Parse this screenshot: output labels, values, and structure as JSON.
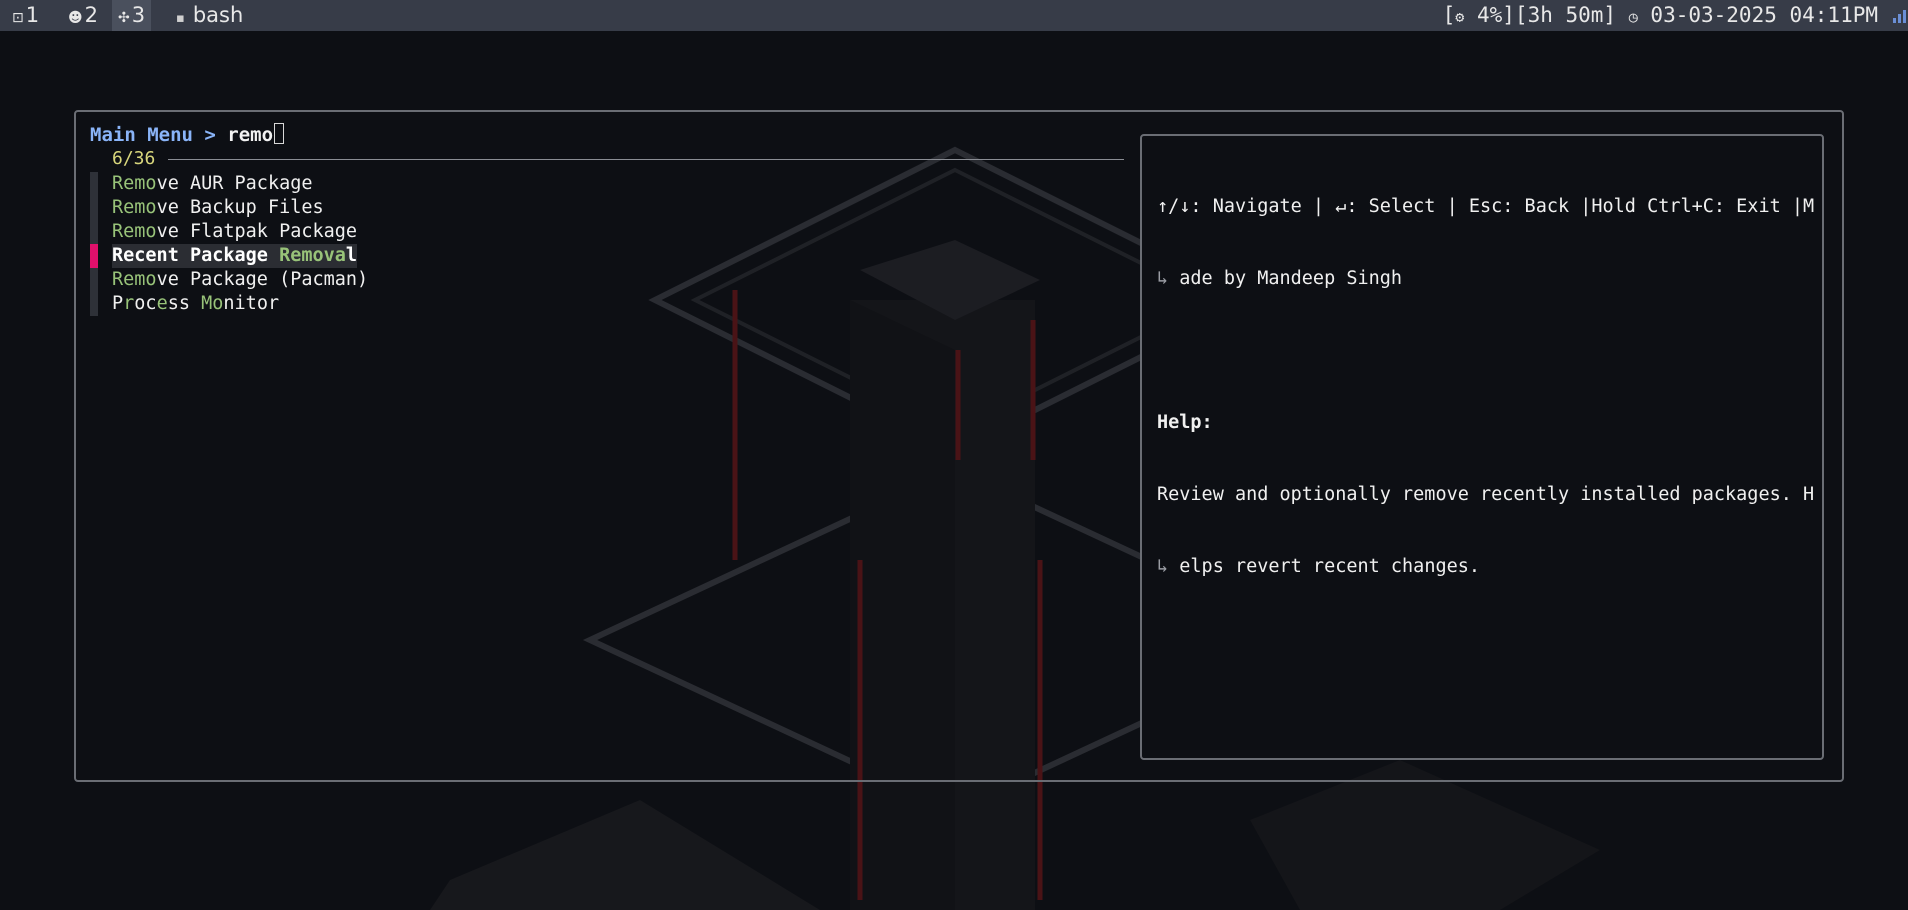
{
  "topbar": {
    "workspaces": [
      {
        "icon": "terminal-icon",
        "glyph": "⊡",
        "label": "1"
      },
      {
        "icon": "gamepad-icon",
        "glyph": "☻",
        "label": "2"
      },
      {
        "icon": "cluster-icon",
        "glyph": "✣",
        "label": "3"
      }
    ],
    "window_title": "bash",
    "status": {
      "cpu": "4%]",
      "uptime": "[3h 50m]",
      "datetime": "03-03-2025 04:11PM"
    }
  },
  "prompt": {
    "breadcrumb": "Main Menu > ",
    "query": "remo"
  },
  "results": {
    "count": "6/36",
    "items": [
      {
        "match": "Remo",
        "rest": "ve AUR Package"
      },
      {
        "match": "Remo",
        "rest": "ve Backup Files"
      },
      {
        "match": "Remo",
        "rest": "ve Flatpak Package"
      },
      {
        "pre": "Recent Package ",
        "match": "Remova",
        "rest": "l",
        "selected": true
      },
      {
        "match": "Remo",
        "rest": "ve Package (Pacman)"
      },
      {
        "p1": "P",
        "m1": "r",
        "p2": "oc",
        "m2": "e",
        "p3": "ss ",
        "m3": "Mo",
        "p4": "nitor"
      }
    ]
  },
  "preview": {
    "keys_line": "↑/↓: Navigate | ↵: Select | Esc: Back |Hold Ctrl+C: Exit |M",
    "keys_wrap_marker": "↳",
    "keys_wrap": " ade by Mandeep Singh",
    "help_heading": "Help:",
    "help_line": "Review and optionally remove recently installed packages. H",
    "help_wrap_marker": "↳",
    "help_wrap": " elps revert recent changes."
  },
  "colors": {
    "accent_selected": "#e0106b",
    "match_highlight": "#98c379",
    "count": "#d8d67c",
    "breadcrumb": "#8ab4f8"
  }
}
